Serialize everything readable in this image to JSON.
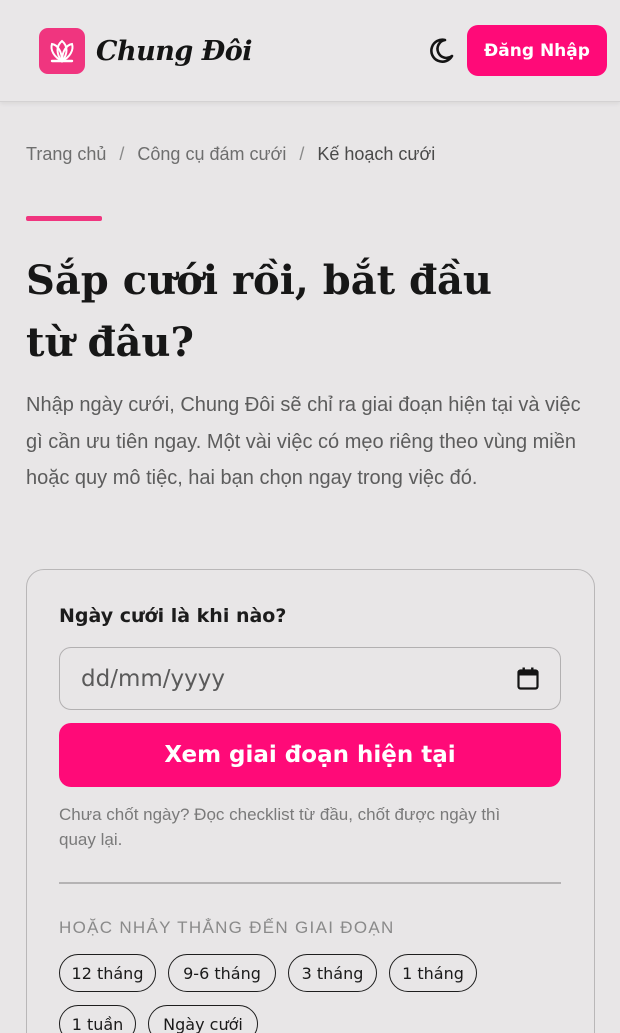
{
  "header": {
    "brand": "Chung Đôi",
    "login_label": "Đăng Nhập",
    "logo_icon": "flower-logo-icon",
    "theme_icon": "moon-icon",
    "accent_color": "#ff0a78"
  },
  "breadcrumb": {
    "items": [
      "Trang chủ",
      "Công cụ đám cưới",
      "Kế hoạch cưới"
    ],
    "separator": "/"
  },
  "hero": {
    "title_line1": "Sắp cưới rồi, bắt đầu",
    "title_line2": "từ đâu?",
    "description": "Nhập ngày cưới, Chung Đôi sẽ chỉ ra giai đoạn hiện tại và việc gì cần ưu tiên ngay. Một vài việc có mẹo riêng theo vùng miền hoặc quy mô tiệc, hai bạn chọn ngay trong việc đó."
  },
  "form": {
    "label": "Ngày cưới là khi nào?",
    "date_placeholder": "dd/mm/yyyy",
    "submit_label": "Xem giai đoạn hiện tại",
    "hint": "Chưa chốt ngày? Đọc checklist từ đầu, chốt được ngày thì quay lại.",
    "jump_label": "HOẶC NHẢY THẲNG ĐẾN GIAI ĐOẠN",
    "stages": [
      "12 tháng",
      "9-6 tháng",
      "3 tháng",
      "1 tháng",
      "1 tuần",
      "Ngày cưới"
    ]
  }
}
